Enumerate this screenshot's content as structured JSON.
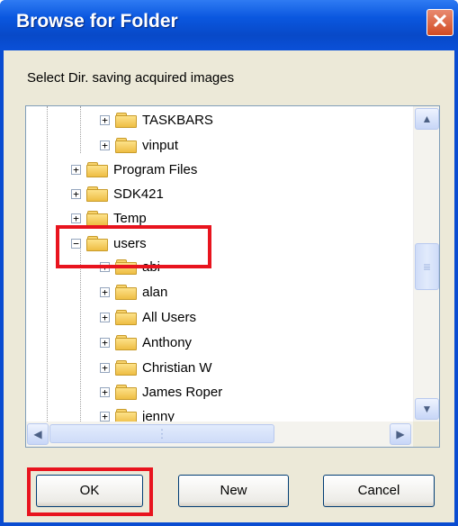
{
  "window": {
    "title": "Browse for Folder",
    "close_label": "✕"
  },
  "prompt": "Select Dir. saving acquired images",
  "tree": {
    "items": [
      {
        "label": "TASKBARS",
        "expander": "+"
      },
      {
        "label": "vinput",
        "expander": "+"
      },
      {
        "label": "Program Files",
        "expander": "+"
      },
      {
        "label": "SDK421",
        "expander": "+"
      },
      {
        "label": "Temp",
        "expander": "+"
      },
      {
        "label": "users",
        "expander": "−"
      },
      {
        "label": "abi",
        "expander": "+"
      },
      {
        "label": "alan",
        "expander": "+"
      },
      {
        "label": "All Users",
        "expander": "+"
      },
      {
        "label": "Anthony",
        "expander": "+"
      },
      {
        "label": "Christian W",
        "expander": "+"
      },
      {
        "label": "James  Roper",
        "expander": "+"
      },
      {
        "label": "jenny",
        "expander": "+"
      }
    ]
  },
  "scrollbar": {
    "up": "▲",
    "down": "▼",
    "left": "◀",
    "right": "▶",
    "grip": "≡",
    "hgrip": "⋮"
  },
  "buttons": {
    "ok": "OK",
    "new": "New",
    "cancel": "Cancel"
  },
  "colors": {
    "highlight": "#e8141e",
    "titlebar": "#0a57df"
  }
}
